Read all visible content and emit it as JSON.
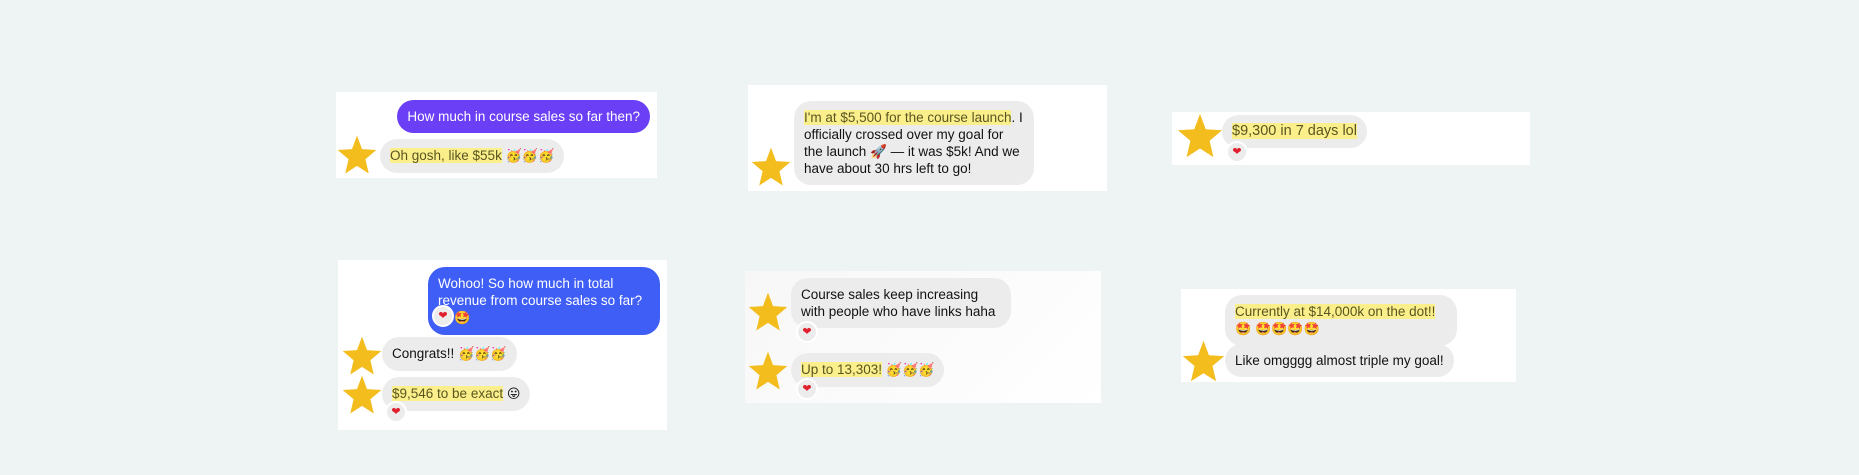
{
  "colors": {
    "background": "#eef4f3",
    "received_bubble": "#ececec",
    "sent_purple": "#6b3ff5",
    "sent_blue": "#3f5ef5",
    "highlight": "#fbef8c",
    "star": "#f2bd1d",
    "heart": "#e0202e"
  },
  "icons": {
    "avatar": "star-icon",
    "reaction": "heart-icon"
  },
  "reaction_glyph": "❤",
  "conversations": [
    {
      "messages": [
        {
          "text": "How much in course sales so far then?"
        },
        {
          "highlight": "Oh gosh, like $55k",
          "emoji": "🥳🥳🥳"
        }
      ]
    },
    {
      "messages": [
        {
          "highlight": "I'm at $5,500 for the course launch",
          "rest": ". I officially crossed over my goal for the launch 🚀 — it was $5k! And we have about 30 hrs left to go!"
        }
      ]
    },
    {
      "messages": [
        {
          "highlight": "$9,300 in 7 days lol"
        }
      ]
    },
    {
      "messages": [
        {
          "text": "Wohoo! So how much in total revenue from course sales so far?",
          "emoji": "🤩🤩"
        },
        {
          "text": "Congrats!!",
          "emoji": "🥳🥳🥳"
        },
        {
          "highlight": "$9,546 to be exact",
          "emoji": "😛"
        }
      ]
    },
    {
      "messages": [
        {
          "text": "Course sales keep increasing with people who have links haha"
        },
        {
          "highlight": "Up to 13,303!",
          "emoji": "🥳🥳🥳"
        }
      ]
    },
    {
      "messages": [
        {
          "highlight": "Currently at $14,000k on the dot!!",
          "emoji": "🤩",
          "emoji2": "🤩🤩🤩🤩"
        },
        {
          "text": "Like omgggg almost triple my goal!"
        }
      ]
    }
  ]
}
